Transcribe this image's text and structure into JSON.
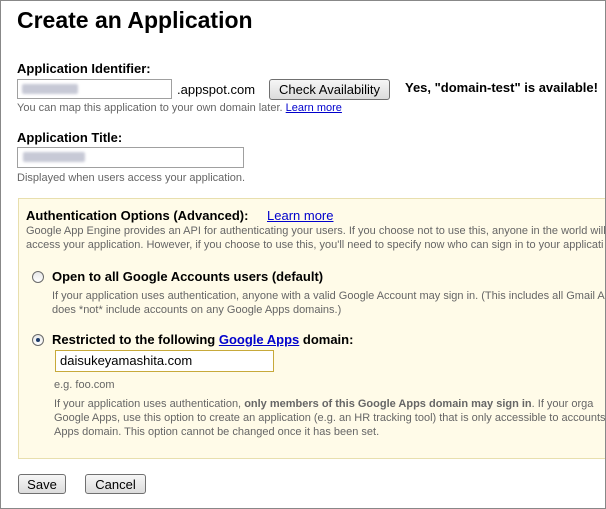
{
  "page": {
    "title": "Create an Application"
  },
  "identifier": {
    "label": "Application Identifier:",
    "suffix": ".appspot.com",
    "check_button": "Check Availability",
    "availability_message": "Yes, \"domain-test\" is available!",
    "help": "You can map this application to your own domain later.",
    "help_link": "Learn more"
  },
  "app_title": {
    "label": "Application Title:",
    "help": "Displayed when users access your application."
  },
  "auth": {
    "heading": "Authentication Options (Advanced):",
    "learn_more": "Learn more",
    "desc_line1": "Google App Engine provides an API for authenticating your users. If you choose not to use this, anyone in the world will",
    "desc_line2": "access your application. However, if you choose to use this, you'll need to specify now who can sign in to your applicati",
    "option_open": {
      "label": "Open to all Google Accounts users (default)",
      "desc_line1": "If your application uses authentication, anyone with a valid Google Account may sign in. (This includes all Gmail Ac",
      "desc_line2": "does *not* include accounts on any Google Apps domains.)"
    },
    "option_restricted": {
      "label_before": "Restricted to the following",
      "label_link": "Google Apps",
      "label_after": "domain:",
      "domain_value": "daisukeyamashita.com",
      "example": "e.g. foo.com",
      "desc_line1_before": "If your application uses authentication,",
      "desc_line1_bold": "only members of this Google Apps domain may sign in",
      "desc_line1_after": ". If your orga",
      "desc_line2": "Google Apps, use this option to create an application (e.g. an HR tracking tool) that is only accessible to accounts o",
      "desc_line3": "Apps domain. This option cannot be changed once it has been set."
    },
    "selected": "restricted"
  },
  "actions": {
    "save": "Save",
    "cancel": "Cancel"
  }
}
